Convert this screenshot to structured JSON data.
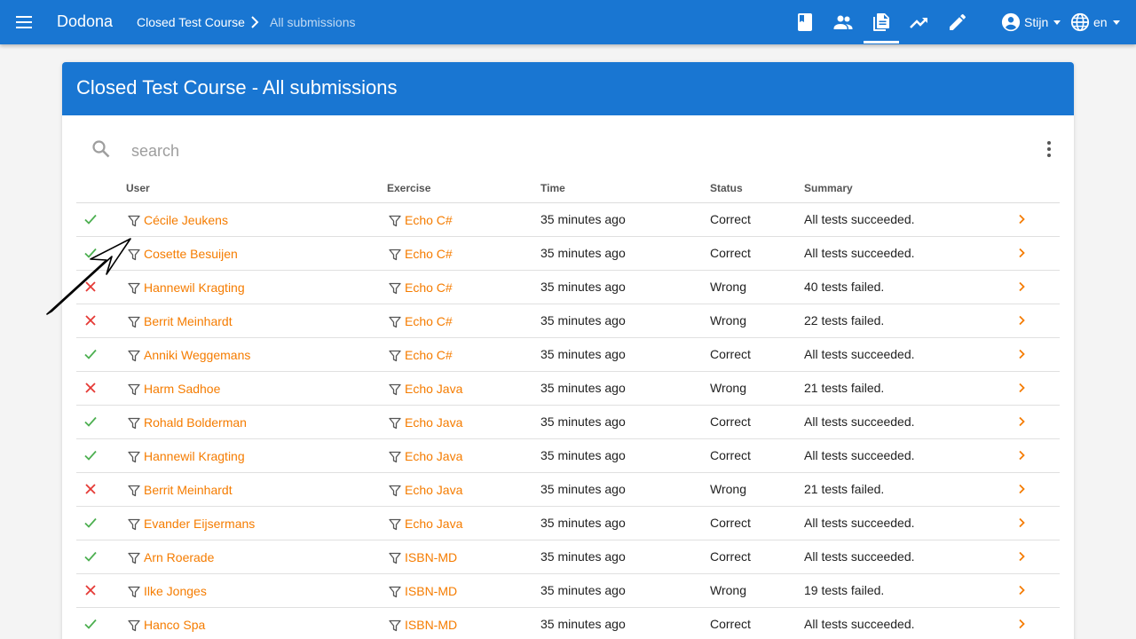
{
  "app": {
    "brand": "Dodona",
    "breadcrumb": [
      "Closed Test Course",
      "All submissions"
    ]
  },
  "nav": {
    "icons": [
      "book-icon",
      "people-icon",
      "submissions-icon",
      "trending-icon",
      "pencil-icon"
    ],
    "active": "submissions-icon",
    "user": "Stijn",
    "language": "en"
  },
  "page": {
    "title": "Closed Test Course - All submissions"
  },
  "search": {
    "placeholder": "search",
    "value": ""
  },
  "table": {
    "columns": [
      "User",
      "Exercise",
      "Time",
      "Status",
      "Summary"
    ],
    "rows": [
      {
        "ok": true,
        "user": "Cécile Jeukens",
        "exercise": "Echo C#",
        "time": "35 minutes ago",
        "status": "Correct",
        "summary": "All tests succeeded."
      },
      {
        "ok": true,
        "user": "Cosette Besuijen",
        "exercise": "Echo C#",
        "time": "35 minutes ago",
        "status": "Correct",
        "summary": "All tests succeeded."
      },
      {
        "ok": false,
        "user": "Hannewil Kragting",
        "exercise": "Echo C#",
        "time": "35 minutes ago",
        "status": "Wrong",
        "summary": "40 tests failed."
      },
      {
        "ok": false,
        "user": "Berrit Meinhardt",
        "exercise": "Echo C#",
        "time": "35 minutes ago",
        "status": "Wrong",
        "summary": "22 tests failed."
      },
      {
        "ok": true,
        "user": "Anniki Weggemans",
        "exercise": "Echo C#",
        "time": "35 minutes ago",
        "status": "Correct",
        "summary": "All tests succeeded."
      },
      {
        "ok": false,
        "user": "Harm Sadhoe",
        "exercise": "Echo Java",
        "time": "35 minutes ago",
        "status": "Wrong",
        "summary": "21 tests failed."
      },
      {
        "ok": true,
        "user": "Rohald Bolderman",
        "exercise": "Echo Java",
        "time": "35 minutes ago",
        "status": "Correct",
        "summary": "All tests succeeded."
      },
      {
        "ok": true,
        "user": "Hannewil Kragting",
        "exercise": "Echo Java",
        "time": "35 minutes ago",
        "status": "Correct",
        "summary": "All tests succeeded."
      },
      {
        "ok": false,
        "user": "Berrit Meinhardt",
        "exercise": "Echo Java",
        "time": "35 minutes ago",
        "status": "Wrong",
        "summary": "21 tests failed."
      },
      {
        "ok": true,
        "user": "Evander Eijsermans",
        "exercise": "Echo Java",
        "time": "35 minutes ago",
        "status": "Correct",
        "summary": "All tests succeeded."
      },
      {
        "ok": true,
        "user": "Arn Roerade",
        "exercise": "ISBN-MD",
        "time": "35 minutes ago",
        "status": "Correct",
        "summary": "All tests succeeded."
      },
      {
        "ok": false,
        "user": "Ilke Jonges",
        "exercise": "ISBN-MD",
        "time": "35 minutes ago",
        "status": "Wrong",
        "summary": "19 tests failed."
      },
      {
        "ok": true,
        "user": "Hanco Spa",
        "exercise": "ISBN-MD",
        "time": "35 minutes ago",
        "status": "Correct",
        "summary": "All tests succeeded."
      }
    ]
  },
  "colors": {
    "primary": "#1976d2",
    "link": "#f57c00",
    "correct": "#4caf50",
    "wrong": "#e53935"
  }
}
